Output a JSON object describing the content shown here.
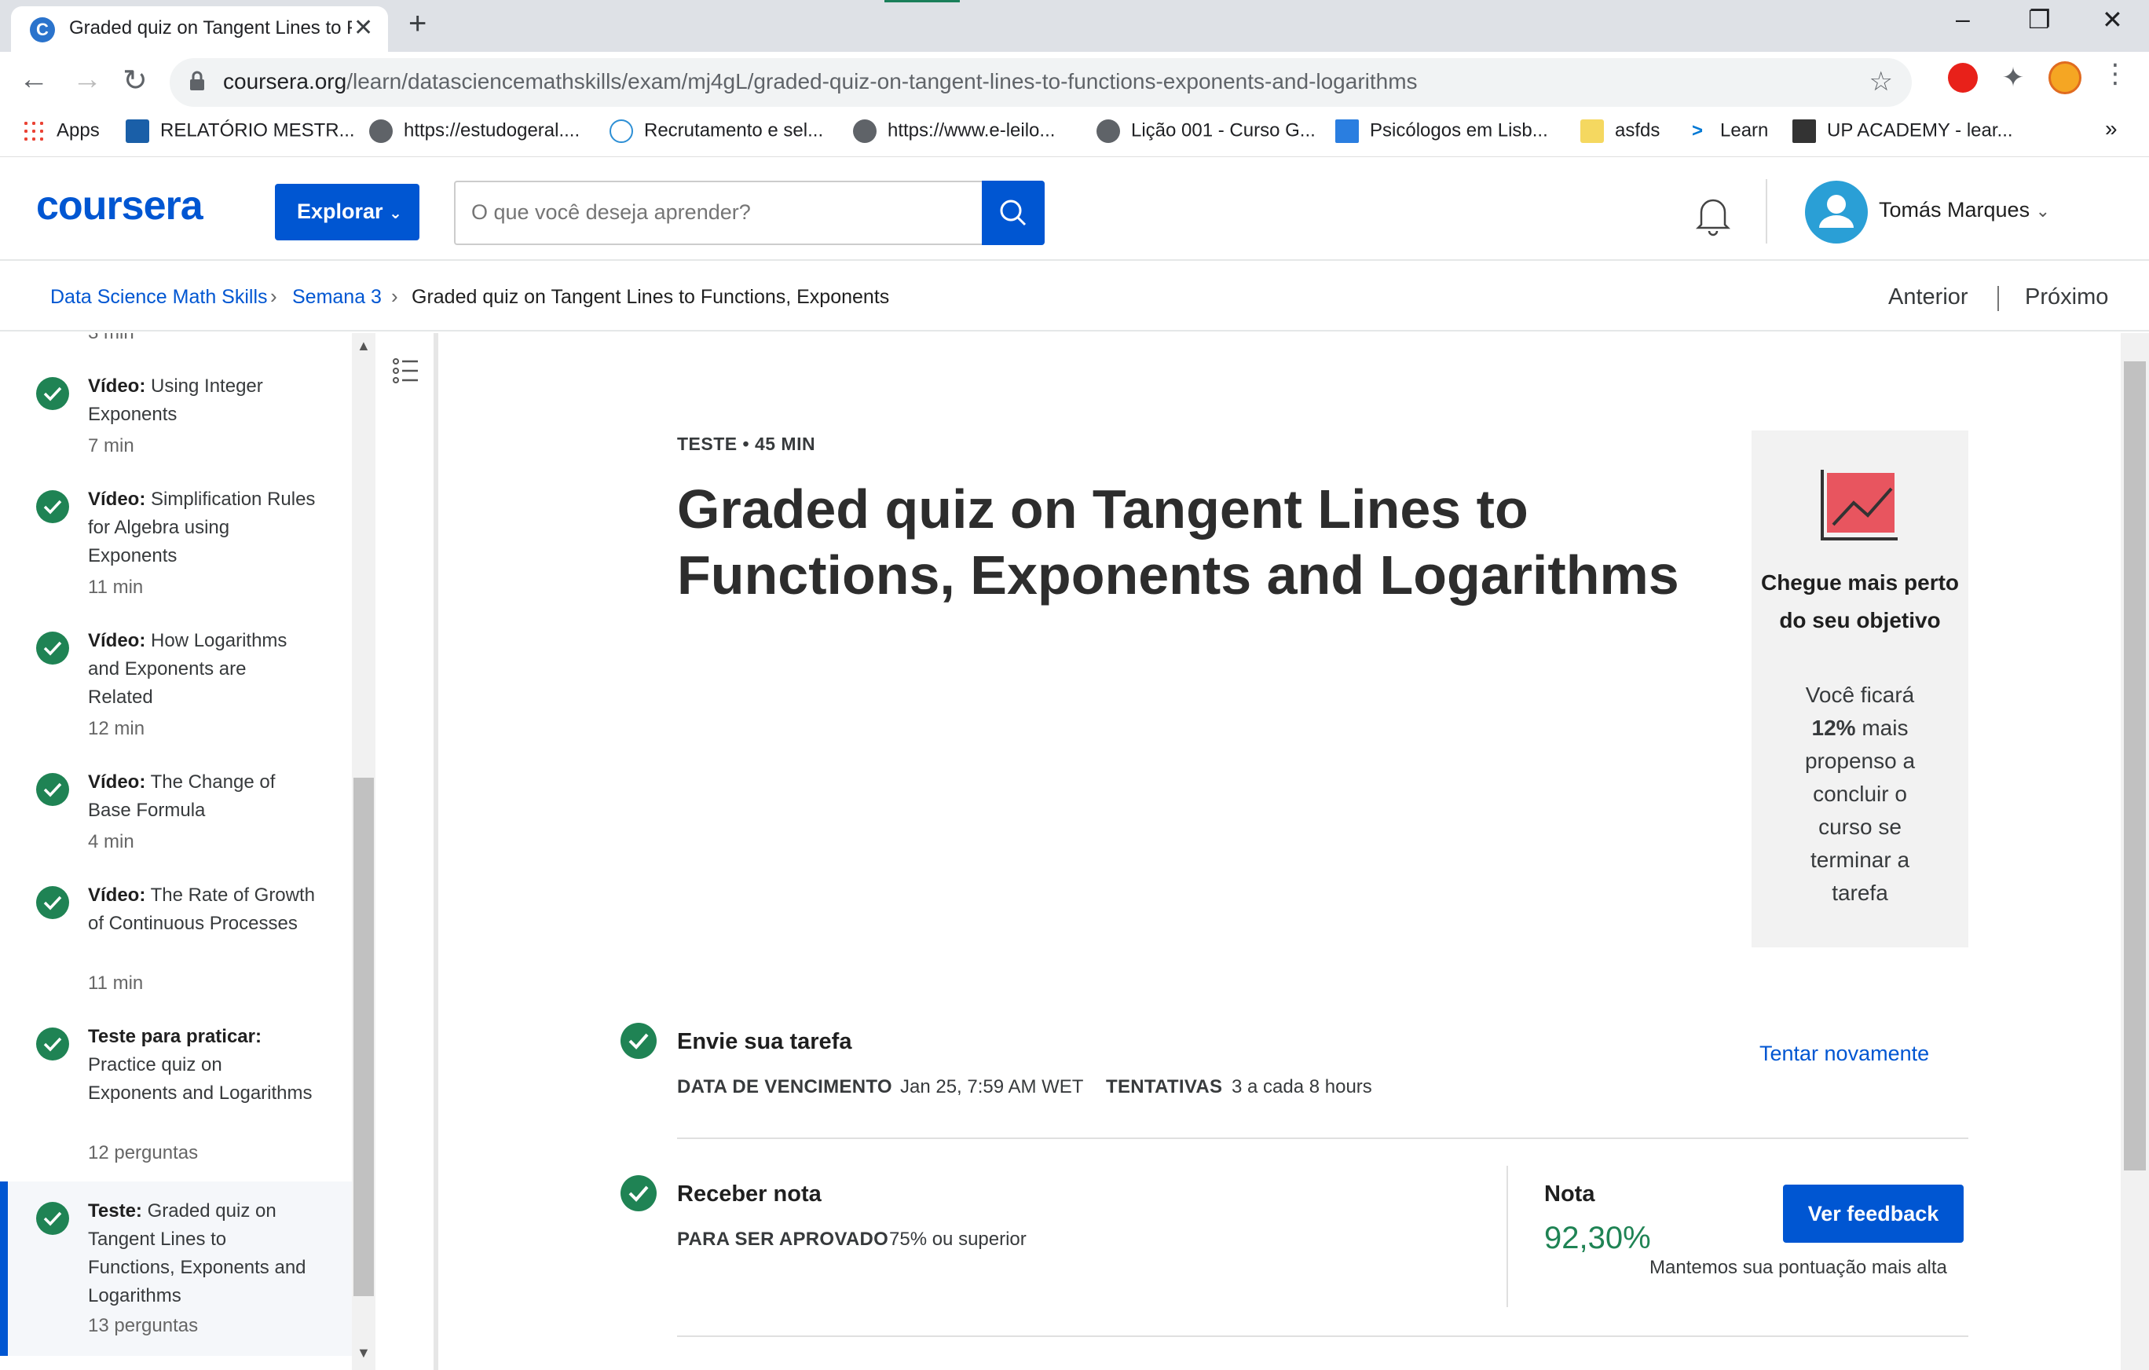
{
  "browser": {
    "tab_title": "Graded quiz on Tangent Lines to Functions, Exponents and Logarithms",
    "url_host": "coursera.org",
    "url_path": "/learn/datasciencemathskills/exam/mj4gL/graded-quiz-on-tangent-lines-to-functions-exponents-and-logarithms",
    "bookmarks": [
      {
        "label": "Apps",
        "icon": "apps-grid-icon"
      },
      {
        "label": "RELATÓRIO MESTR...",
        "icon": "document-icon"
      },
      {
        "label": "https://estudogeral....",
        "icon": "globe-icon"
      },
      {
        "label": "Recrutamento e sel...",
        "icon": "tg-icon"
      },
      {
        "label": "https://www.e-leilo...",
        "icon": "globe-icon"
      },
      {
        "label": "Lição 001 - Curso G...",
        "icon": "globe-icon"
      },
      {
        "label": "Psicólogos em Lisb...",
        "icon": "w-icon"
      },
      {
        "label": "asfds",
        "icon": "folder-icon"
      },
      {
        "label": "Learn",
        "icon": "terminal-icon"
      },
      {
        "label": "UP ACADEMY - lear...",
        "icon": "up-icon"
      }
    ],
    "more_bookmarks": "»"
  },
  "header": {
    "logo": "coursera",
    "explore_label": "Explorar",
    "search_placeholder": "O que você deseja aprender?",
    "user_name": "Tomás Marques"
  },
  "breadcrumb": {
    "items": [
      "Data Science Math Skills",
      "Semana 3"
    ],
    "current": "Graded quiz on Tangent Lines to Functions, Exponents",
    "prev_label": "Anterior",
    "next_label": "Próximo"
  },
  "sidebar": {
    "top_partial_meta": "3 min",
    "items": [
      {
        "type": "Vídeo:",
        "title": "Using Integer Exponents",
        "meta": "7 min"
      },
      {
        "type": "Vídeo:",
        "title": "Simplification Rules for Algebra using Exponents",
        "meta": "11 min"
      },
      {
        "type": "Vídeo:",
        "title": "How Logarithms and Exponents are Related",
        "meta": "12 min"
      },
      {
        "type": "Vídeo:",
        "title": "The Change of Base Formula",
        "meta": "4 min"
      },
      {
        "type": "Vídeo:",
        "title": "The Rate of Growth of Continuous Processes",
        "meta": "11 min"
      },
      {
        "type": "Teste para praticar:",
        "title": "Practice quiz on Exponents and Logarithms",
        "meta": "12 perguntas"
      },
      {
        "type": "Teste:",
        "title": "Graded quiz on Tangent Lines to Functions, Exponents and Logarithms",
        "meta": "13 perguntas"
      }
    ]
  },
  "main": {
    "type_line": "TESTE • 45 MIN",
    "title": "Graded quiz on Tangent Lines to Functions, Exponents and Logarithms",
    "goal_card": {
      "heading": "Chegue mais perto do seu objetivo",
      "body_before": "Você ficará",
      "highlight": "12%",
      "body_after": "mais propenso a concluir o curso se terminar a tarefa",
      "icon_color": "#e8555f"
    },
    "submit": {
      "heading": "Envie sua tarefa",
      "due_label": "DATA DE VENCIMENTO",
      "due_value": "Jan 25, 7:59 AM WET",
      "attempts_label": "TENTATIVAS",
      "attempts_value": "3 a cada 8 hours",
      "retry_label": "Tentar novamente"
    },
    "grade": {
      "heading": "Receber nota",
      "pass_label": "PARA SER APROVADO",
      "pass_value": "75% ou superior",
      "grade_label": "Nota",
      "grade_value": "92,30%",
      "feedback_label": "Ver feedback",
      "keep_note": "Mantemos sua pontuação mais alta"
    }
  },
  "colors": {
    "brand": "#0056d2",
    "success": "#1f8354"
  }
}
